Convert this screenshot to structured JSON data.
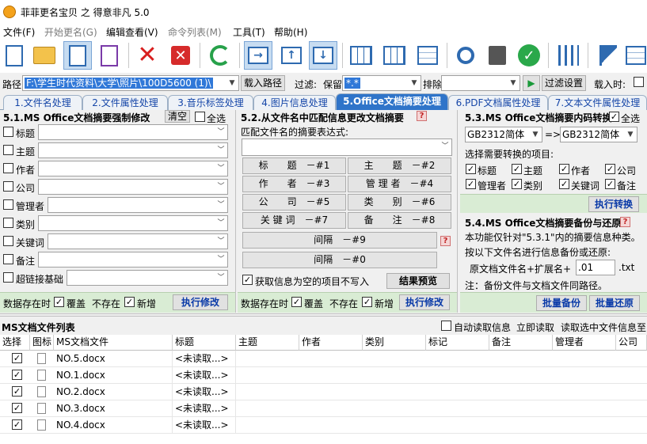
{
  "window": {
    "title": "菲菲更名宝贝 之 得意非凡 5.0"
  },
  "menu": [
    "文件(F)",
    "开始更名(G)",
    "编辑查看(V)",
    "命令列表(M)",
    "工具(T)",
    "帮助(H)"
  ],
  "path_row": {
    "path_label": "路径",
    "path_value": "F:\\学生时代资料\\大学\\照片\\100D5600 (1)\\",
    "load_path_button": "载入路径",
    "filter_label": "过滤:",
    "keep_label": "保留",
    "keep_value": "*.*",
    "exclude_label": "排除",
    "exclude_value": "",
    "filter_settings_button": "过滤设置",
    "load_time_label": "载入时:"
  },
  "tabs": [
    "1.文件名处理",
    "2.文件属性处理",
    "3.音乐标签处理",
    "4.图片信息处理",
    "5.Office文档摘要处理",
    "6.PDF文档属性处理",
    "7.文本文件属性处理"
  ],
  "panel1": {
    "title": "5.1.MS Office文档摘要强制修改",
    "clear_button": "清空",
    "select_all_label": "全选",
    "fields": [
      "标题",
      "主题",
      "作者",
      "公司",
      "管理者",
      "类别",
      "关键词",
      "备注",
      "超链接基础"
    ],
    "exists_label": "数据存在时",
    "overwrite_label": "覆盖",
    "not_exist_label": "不存在",
    "add_label": "新增",
    "execute_button": "执行修改"
  },
  "panel2": {
    "title": "5.2.从文件名中匹配信息更改文档摘要",
    "regex_label": "匹配文件名的摘要表达式:",
    "buttons": [
      "标　　题　－#1",
      "主　　题　－#2",
      "作　　者　－#3",
      "管 理 者　－#4",
      "公　　司　－#5",
      "类　　别　－#6",
      "关 键 词　－#7",
      "备　　注　－#8"
    ],
    "sep9": "间隔　－#9",
    "sep0": "间隔　－#0",
    "empty_label": "获取信息为空的项目不写入",
    "preview_button": "结果预览",
    "exists_label": "数据存在时",
    "overwrite_label": "覆盖",
    "not_exist_label": "不存在",
    "add_label": "新增",
    "execute_button": "执行修改"
  },
  "panel3": {
    "title": "5.3.MS Office文档摘要内码转换",
    "select_all_label": "全选",
    "from_encoding": "GB2312简体",
    "arrow": "=>",
    "to_encoding": "GB2312简体",
    "choose_label": "选择需要转换的项目:",
    "items": [
      "标题",
      "主题",
      "作者",
      "公司",
      "管理者",
      "类别",
      "关键词",
      "备注"
    ],
    "execute_button": "执行转换"
  },
  "panel4": {
    "title": "5.4.MS Office文档摘要备份与还原",
    "desc1": "本功能仅针对\"5.3.1\"内的摘要信息种类。",
    "desc2": "按以下文件名进行信息备份或还原:",
    "name_prefix": "原文档文件名+扩展名+",
    "ext_value": ".01",
    "ext_suffix": ".txt",
    "note": "注：备份文件与文档文件同路径。",
    "backup_button": "批量备份",
    "restore_button": "批量还原"
  },
  "file_list": {
    "title": "MS文档文件列表",
    "auto_read_label": "自动读取信息",
    "read_now": "立即读取",
    "read_selected": "读取选中文件信息至",
    "columns": [
      "选择",
      "图标",
      "MS文档文件",
      "标题",
      "主题",
      "作者",
      "类别",
      "标记",
      "备注",
      "管理者",
      "公司"
    ],
    "rows": [
      {
        "name": "NO.5.docx",
        "title": "<未读取...>"
      },
      {
        "name": "NO.1.docx",
        "title": "<未读取...>"
      },
      {
        "name": "NO.2.docx",
        "title": "<未读取...>"
      },
      {
        "name": "NO.3.docx",
        "title": "<未读取...>"
      },
      {
        "name": "NO.4.docx",
        "title": "<未读取...>"
      }
    ]
  },
  "colors": {
    "accent": "#2f74c9",
    "green_bar": "#d9ecd4",
    "blue_text": "#0a3aa8"
  }
}
